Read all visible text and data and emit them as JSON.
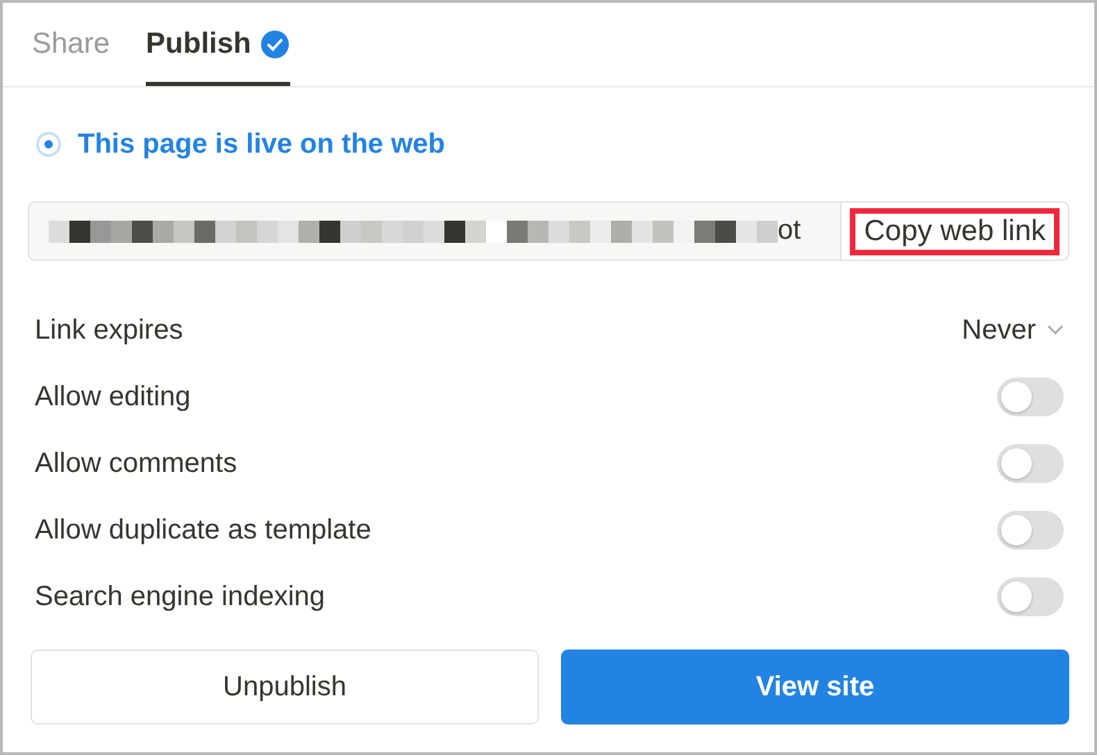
{
  "tabs": [
    {
      "label": "Share",
      "selected": false,
      "verified": false
    },
    {
      "label": "Publish",
      "selected": true,
      "verified": true
    }
  ],
  "status": {
    "label": "This page is live on the web",
    "selected": true
  },
  "link": {
    "url_tail": "ot",
    "button": "Copy web link",
    "highlighted": true
  },
  "expiry": {
    "label": "Link expires",
    "value": "Never"
  },
  "options": [
    {
      "label": "Allow editing",
      "on": false
    },
    {
      "label": "Allow comments",
      "on": false
    },
    {
      "label": "Allow duplicate as template",
      "on": false
    },
    {
      "label": "Search engine indexing",
      "on": false
    }
  ],
  "buttons": [
    {
      "label": "Unpublish",
      "kind": "secondary"
    },
    {
      "label": "View site",
      "kind": "primary"
    }
  ]
}
